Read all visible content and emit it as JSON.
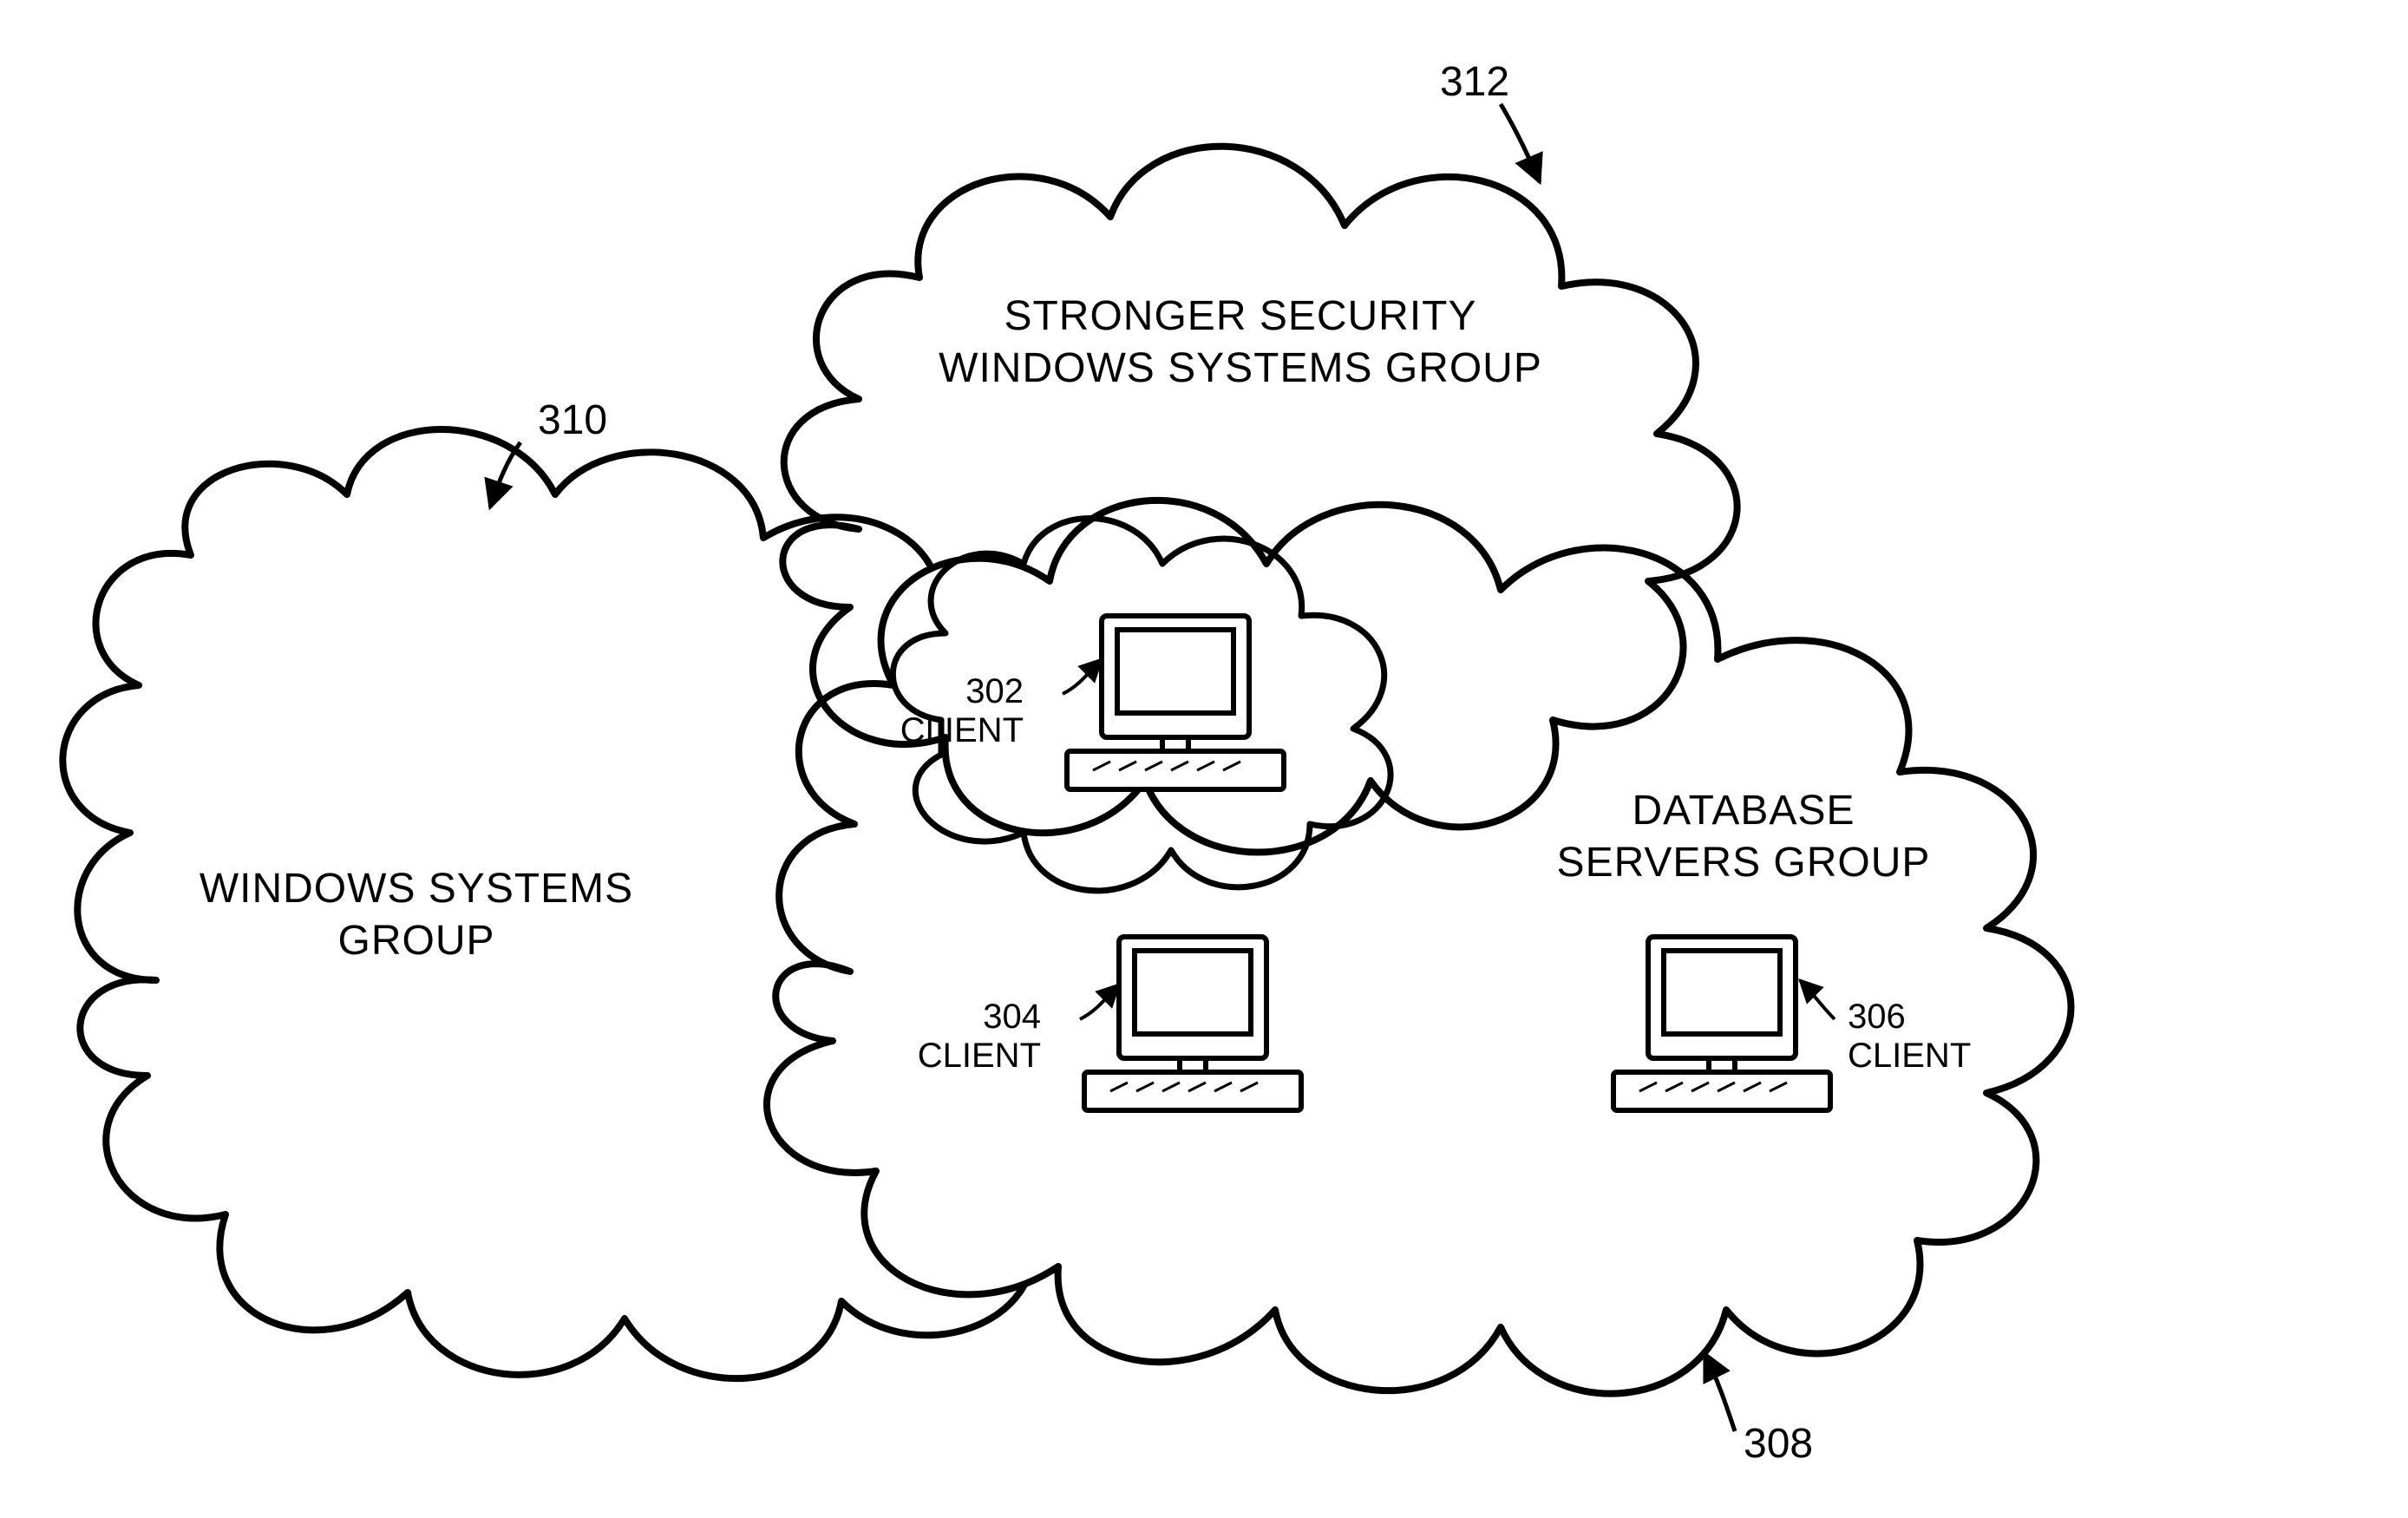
{
  "groups": {
    "top": {
      "ref": "312",
      "line1": "STRONGER SECURITY",
      "line2": "WINDOWS SYSTEMS GROUP"
    },
    "left": {
      "ref": "310",
      "line1": "WINDOWS SYSTEMS",
      "line2": "GROUP"
    },
    "right": {
      "ref": "308",
      "line1": "DATABASE",
      "line2": "SERVERS GROUP"
    }
  },
  "clients": {
    "c302": {
      "ref": "302",
      "label": "CLIENT"
    },
    "c304": {
      "ref": "304",
      "label": "CLIENT"
    },
    "c306": {
      "ref": "306",
      "label": "CLIENT"
    }
  }
}
